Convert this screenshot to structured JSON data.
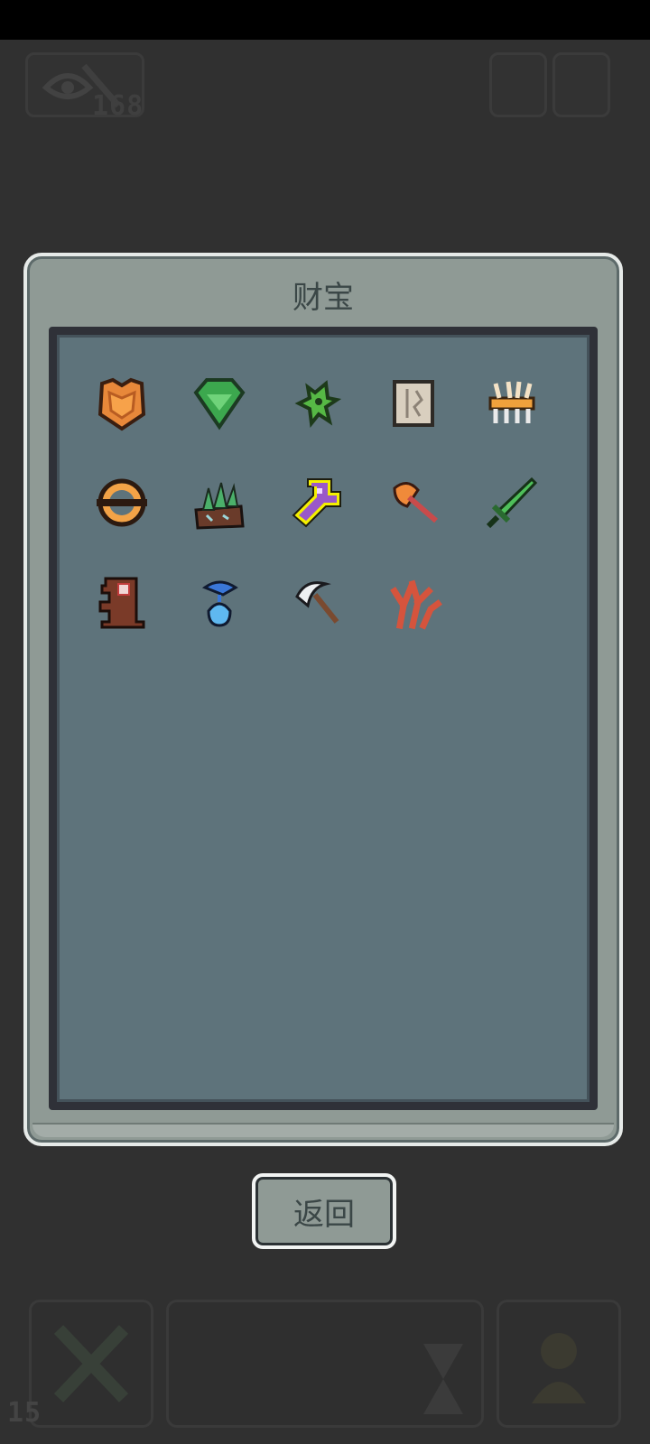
{
  "hud": {
    "resource_count": "168",
    "turn_count": "15"
  },
  "dialog": {
    "title": "财宝"
  },
  "treasures": [
    {
      "icon": "orange-armor-icon"
    },
    {
      "icon": "green-gem-icon"
    },
    {
      "icon": "green-creature-icon"
    },
    {
      "icon": "parchment-scroll-icon"
    },
    {
      "icon": "bone-claw-icon"
    },
    {
      "icon": "orange-ring-icon"
    },
    {
      "icon": "crystal-rock-icon"
    },
    {
      "icon": "purple-key-icon",
      "selected": true
    },
    {
      "icon": "fire-axe-icon"
    },
    {
      "icon": "green-sword-icon"
    },
    {
      "icon": "wooden-totem-icon"
    },
    {
      "icon": "blue-potion-icon"
    },
    {
      "icon": "scythe-icon"
    },
    {
      "icon": "red-coral-icon"
    }
  ],
  "buttons": {
    "back_label": "返回"
  },
  "colors": {
    "selected_outline": "#f4f000",
    "panel": "#5e737b",
    "dialog": "#8f9a95"
  }
}
